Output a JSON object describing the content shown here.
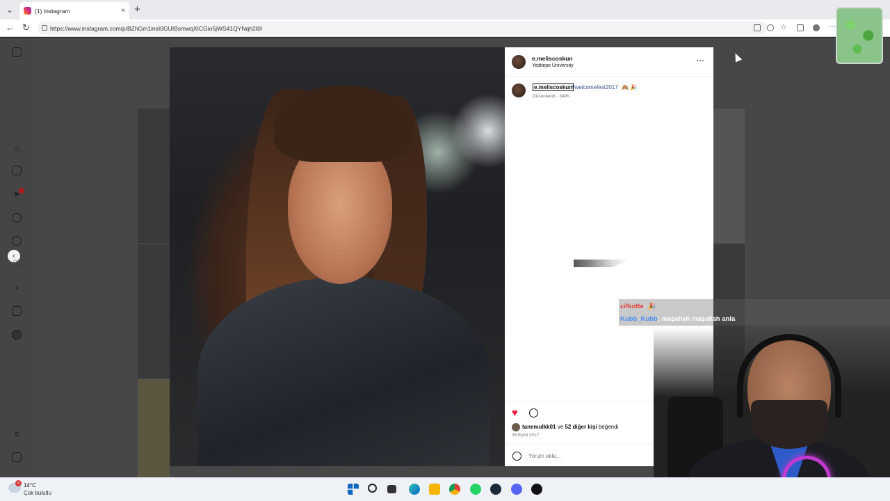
{
  "browser": {
    "tab_title": "(1) Instagram",
    "tab_close": "×",
    "new_tab": "+",
    "url": "https://www.instagram.com/p/BZhGm1insI0GUIBsmwqXICGio5jWS41QYNqh2I0/"
  },
  "post": {
    "username": "e.meliscoskun",
    "location": "Yeditepe University",
    "more_label": "...",
    "caption_user": "e.meliscoskun",
    "caption_hashtag": "#welcomefest2017",
    "caption_emoji": "🙈 🎉",
    "caption_meta": "Düzenlendi · 349h",
    "likes_user": "tanemulkk01",
    "likes_rest": " ve ",
    "likes_count": "52 diğer kişi",
    "likes_suffix": " beğendi",
    "date": "26 Eylül 2017",
    "comment_placeholder": "Yorum ekle...",
    "liked_color": "#ed1c40"
  },
  "sidebar": {
    "collapse": "‹"
  },
  "chat": {
    "line1_user": "cifkofte",
    "line1_text": ": 🎉",
    "line2_user": "Kubb_Kubb",
    "line2_text": ": maşallah maşallah anla"
  },
  "taskbar": {
    "notif_count": "4",
    "temp": "14°C",
    "weather": "Çok bulutlu"
  }
}
